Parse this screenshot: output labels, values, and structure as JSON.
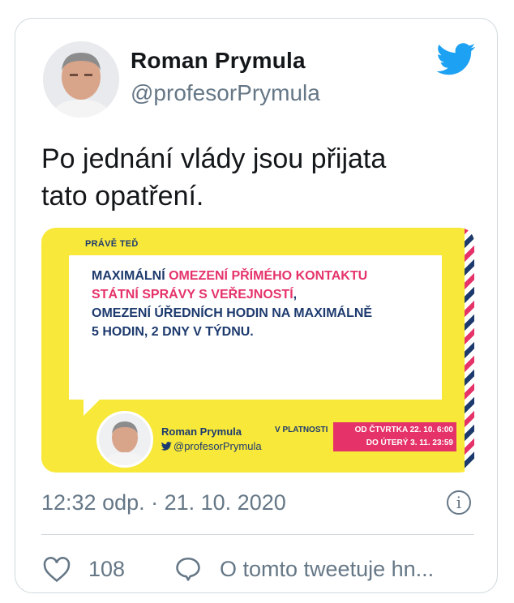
{
  "author": {
    "name": "Roman Prymula",
    "handle": "@profesorPrymula"
  },
  "tweet": {
    "text_line1": "Po jednání vlády jsou přijata",
    "text_line2": "tato opatření."
  },
  "media": {
    "label": "PRÁVĚ TEĎ",
    "msg_part1": "MAXIMÁLNÍ ",
    "msg_part2": "OMEZENÍ PŘÍMÉHO KONTAKTU",
    "msg_part3": "STÁTNÍ SPRÁVY S VEŘEJNOSTÍ",
    "msg_part4": ",",
    "msg_part5": "OMEZENÍ ÚŘEDNÍCH HODIN NA MAXIMÁLNĚ",
    "msg_part6": "5 HODIN, 2 DNY V TÝDNU.",
    "author_name": "Roman Prymula",
    "author_handle": "@profesorPrymula",
    "validity_label": "V PLATNOSTI",
    "date_from": "OD ČTVRTKA 22. 10. 6:00",
    "date_to": "DO ÚTERÝ 3. 11. 23:59",
    "colors": {
      "background": "#f8e83a",
      "navy": "#1d3a6e",
      "pink": "#e5336a"
    }
  },
  "meta": {
    "timestamp": "12:32 odp. · 21. 10. 2020",
    "info_icon": "i"
  },
  "actions": {
    "likes": "108",
    "reply_label": "O tomto tweetuje hn..."
  },
  "colors": {
    "twitter_blue": "#1da1f2",
    "secondary_text": "#657786"
  }
}
